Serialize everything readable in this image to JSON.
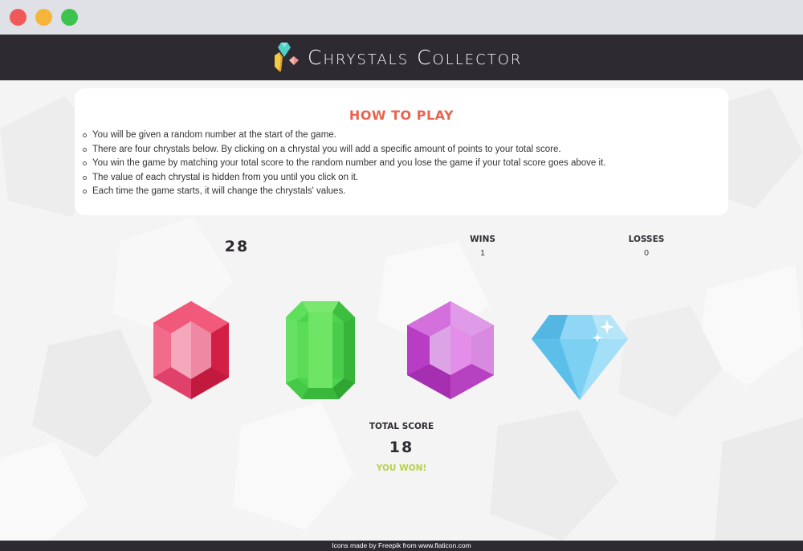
{
  "app": {
    "title": "Chrystals Collector",
    "accent": "#e9644e",
    "header_bg": "#2e2a32",
    "win_color": "#b6d24a"
  },
  "window_controls": [
    "close",
    "minimize",
    "maximize"
  ],
  "how_to_play": {
    "heading": "HOW TO PLAY",
    "items": [
      "You will be given a random number at the start of the game.",
      "There are four chrystals below. By clicking on a chrystal you will add a specific amount of points to your total score.",
      "You win the game by matching your total score to the random number and you lose the game if your total score goes above it.",
      "The value of each chrystal is hidden from you until you click on it.",
      "Each time the game starts, it will change the chrystals' values."
    ]
  },
  "game": {
    "target_number": "28",
    "wins_label": "WINS",
    "wins": "1",
    "losses_label": "LOSSES",
    "losses": "0",
    "total_label": "TOTAL SCORE",
    "total_score": "18",
    "result": "YOU WON!"
  },
  "crystals": [
    {
      "icon": "red-hexagon-crystal-icon",
      "color": "#e92f58"
    },
    {
      "icon": "green-emerald-crystal-icon",
      "color": "#4dd44e"
    },
    {
      "icon": "purple-hexagon-crystal-icon",
      "color": "#c94ad3"
    },
    {
      "icon": "blue-diamond-crystal-icon",
      "color": "#6cc8ee"
    }
  ],
  "footer": {
    "credit": "Icons made by Freepik from www.flaticon.com"
  }
}
